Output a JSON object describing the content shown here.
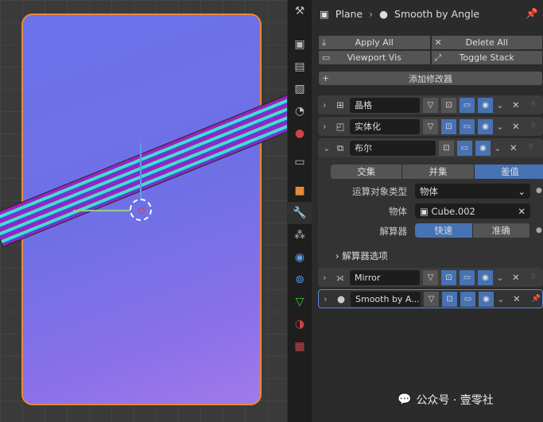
{
  "header": {
    "object": "Plane",
    "modifier": "Smooth by Angle"
  },
  "toolbar": {
    "apply_all": "Apply All",
    "delete_all": "Delete All",
    "viewport_vis": "Viewport Vis",
    "toggle_stack": "Toggle Stack",
    "add_modifier": "添加修改器"
  },
  "modifiers": [
    {
      "name": "晶格"
    },
    {
      "name": "实体化"
    },
    {
      "name": "布尔"
    },
    {
      "name": "Mirror"
    },
    {
      "name": "Smooth by A..."
    }
  ],
  "boolean": {
    "ops": [
      "交集",
      "并集",
      "差值"
    ],
    "operand_label": "运算对象类型",
    "operand_value": "物体",
    "object_label": "物体",
    "object_value": "Cube.002",
    "solver_label": "解算器",
    "solvers": [
      "快速",
      "准确"
    ],
    "solver_options": "解算器选项"
  },
  "watermark": "公众号 · 壹零社",
  "colors": {
    "accent": "#4772b3",
    "selection": "#e8893a"
  }
}
